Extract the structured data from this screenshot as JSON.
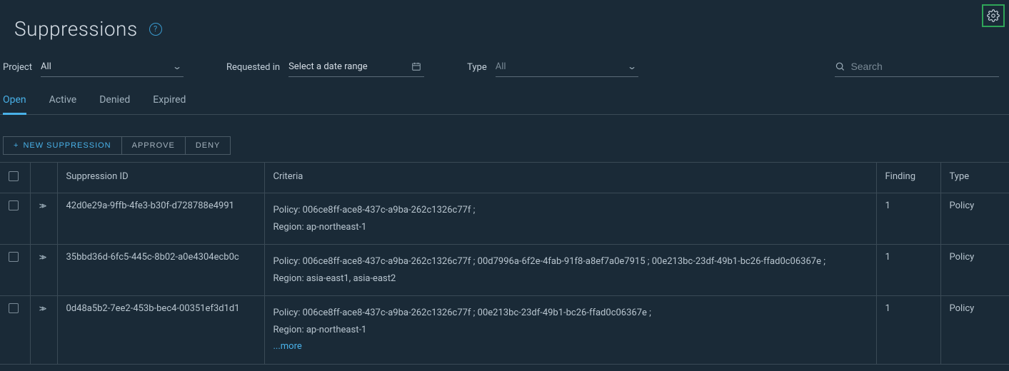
{
  "page": {
    "title": "Suppressions"
  },
  "filters": {
    "project": {
      "label": "Project",
      "value": "All"
    },
    "requested": {
      "label": "Requested in",
      "placeholder": "Select a date range"
    },
    "type": {
      "label": "Type",
      "value": "All"
    },
    "search_placeholder": "Search"
  },
  "tabs": {
    "open": "Open",
    "active": "Active",
    "denied": "Denied",
    "expired": "Expired"
  },
  "toolbar": {
    "new_suppression": "NEW SUPPRESSION",
    "approve": "APPROVE",
    "deny": "DENY"
  },
  "table": {
    "headers": {
      "suppression_id": "Suppression ID",
      "criteria": "Criteria",
      "finding": "Finding",
      "type": "Type"
    },
    "rows": [
      {
        "id": "42d0e29a-9ffb-4fe3-b30f-d728788e4991",
        "criteria_policy": "Policy: 006ce8ff-ace8-437c-a9ba-262c1326c77f ;",
        "criteria_region": "Region: ap-northeast-1",
        "finding": "1",
        "type": "Policy",
        "has_more": false
      },
      {
        "id": "35bbd36d-6fc5-445c-8b02-a0e4304ecb0c",
        "criteria_policy": "Policy: 006ce8ff-ace8-437c-a9ba-262c1326c77f ; 00d7996a-6f2e-4fab-91f8-a8ef7a0e7915 ; 00e213bc-23df-49b1-bc26-ffad0c06367e ;",
        "criteria_region": "Region: asia-east1, asia-east2",
        "finding": "1",
        "type": "Policy",
        "has_more": false
      },
      {
        "id": "0d48a5b2-7ee2-453b-bec4-00351ef3d1d1",
        "criteria_policy": "Policy: 006ce8ff-ace8-437c-a9ba-262c1326c77f ; 00e213bc-23df-49b1-bc26-ffad0c06367e ;",
        "criteria_region": "Region: ap-northeast-1",
        "finding": "1",
        "type": "Policy",
        "has_more": true,
        "more_label": "...more"
      }
    ]
  }
}
